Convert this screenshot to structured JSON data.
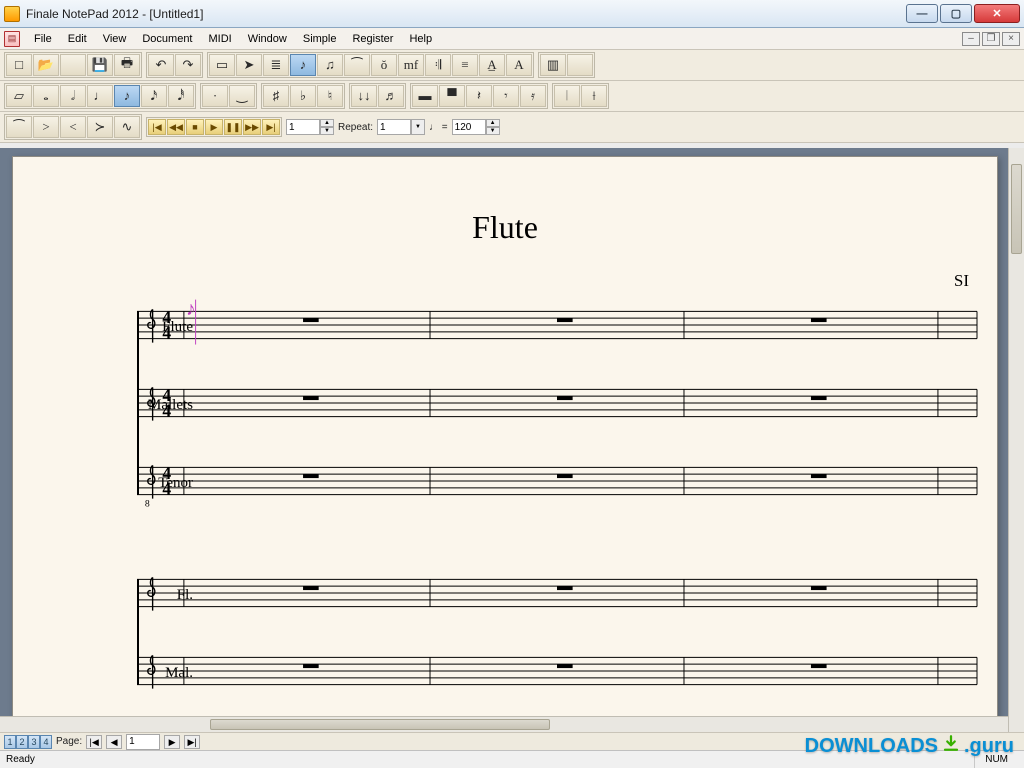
{
  "window": {
    "title": "Finale NotePad 2012 - [Untitled1]"
  },
  "menu": [
    "File",
    "Edit",
    "View",
    "Document",
    "MIDI",
    "Window",
    "Simple",
    "Register",
    "Help"
  ],
  "toolbar1": {
    "groups": [
      {
        "items": [
          {
            "name": "new-icon",
            "glyph": "□"
          },
          {
            "name": "open-icon",
            "glyph": "📂"
          },
          {
            "name": "blank1",
            "glyph": ""
          },
          {
            "name": "save-icon",
            "glyph": "💾"
          },
          {
            "name": "print-icon",
            "glyph": "🖶"
          }
        ]
      },
      {
        "items": [
          {
            "name": "undo-icon",
            "glyph": "↶"
          },
          {
            "name": "redo-icon",
            "glyph": "↷"
          }
        ]
      },
      {
        "items": [
          {
            "name": "select-tool-icon",
            "glyph": "▭"
          },
          {
            "name": "arrow-tool-icon",
            "glyph": "➤"
          },
          {
            "name": "measure-tool-icon",
            "glyph": "≣"
          },
          {
            "name": "simple-entry-icon",
            "glyph": "♪",
            "active": true
          },
          {
            "name": "tuplet-tool-icon",
            "glyph": "♫"
          },
          {
            "name": "slur-tool-icon",
            "glyph": "⁀"
          },
          {
            "name": "articulation-tool-icon",
            "glyph": "ŏ"
          },
          {
            "name": "dyn-tool-icon",
            "glyph": "𝆐",
            "label": "mf"
          },
          {
            "name": "repeat-tool-icon",
            "glyph": "𝄇"
          },
          {
            "name": "lyric-tool-icon",
            "glyph": "≡"
          },
          {
            "name": "text-ul-icon",
            "glyph": "A̲"
          },
          {
            "name": "text-tool-icon",
            "glyph": "A"
          }
        ]
      },
      {
        "items": [
          {
            "name": "page-tool-icon",
            "glyph": "▥"
          },
          {
            "name": "blank2",
            "glyph": ""
          }
        ]
      }
    ]
  },
  "toolbar2": {
    "groups": [
      {
        "items": [
          {
            "name": "eraser-icon",
            "glyph": "▱"
          },
          {
            "name": "whole-note-icon",
            "glyph": "𝅝"
          },
          {
            "name": "half-note-icon",
            "glyph": "𝅗𝅥"
          },
          {
            "name": "quarter-note-icon",
            "glyph": "♩"
          },
          {
            "name": "eighth-note-icon",
            "glyph": "♪",
            "active": true
          },
          {
            "name": "sixteenth-note-icon",
            "glyph": "𝅘𝅥𝅯"
          },
          {
            "name": "thirtysecond-note-icon",
            "glyph": "𝅘𝅥𝅰"
          }
        ]
      },
      {
        "items": [
          {
            "name": "dot-icon",
            "glyph": "·"
          },
          {
            "name": "tie-icon",
            "glyph": "‿"
          }
        ]
      },
      {
        "items": [
          {
            "name": "sharp-icon",
            "glyph": "♯"
          },
          {
            "name": "flat-icon",
            "glyph": "♭"
          },
          {
            "name": "natural-icon",
            "glyph": "♮"
          }
        ]
      },
      {
        "items": [
          {
            "name": "tuplet-icon",
            "glyph": "↓↓"
          },
          {
            "name": "grace-icon",
            "glyph": "♬"
          }
        ]
      },
      {
        "items": [
          {
            "name": "whole-rest-icon",
            "glyph": "▬"
          },
          {
            "name": "half-rest-icon",
            "glyph": "▀"
          },
          {
            "name": "quarter-rest-icon",
            "glyph": "𝄽"
          },
          {
            "name": "eighth-rest-icon",
            "glyph": "𝄾"
          },
          {
            "name": "sixteenth-rest-icon",
            "glyph": "𝄿"
          }
        ]
      },
      {
        "items": [
          {
            "name": "barline-icon",
            "glyph": "𝄀"
          },
          {
            "name": "cut-barline-icon",
            "glyph": "⟊"
          }
        ]
      }
    ]
  },
  "toolbar3": {
    "cresc": [
      {
        "name": "slur-down-icon",
        "glyph": "⁀"
      },
      {
        "name": "decr-icon",
        "glyph": ">"
      },
      {
        "name": "cresc-icon",
        "glyph": "<"
      },
      {
        "name": "cresc2-icon",
        "glyph": "≻"
      },
      {
        "name": "trill-icon",
        "glyph": "∿"
      }
    ],
    "playback": [
      {
        "name": "rewind-full-icon",
        "glyph": "|◀"
      },
      {
        "name": "rewind-icon",
        "glyph": "◀◀"
      },
      {
        "name": "stop-icon",
        "glyph": "■"
      },
      {
        "name": "play-icon",
        "glyph": "▶"
      },
      {
        "name": "pause-icon",
        "glyph": "❚❚"
      },
      {
        "name": "ffwd-icon",
        "glyph": "▶▶"
      },
      {
        "name": "ffwd-full-icon",
        "glyph": "▶|"
      }
    ],
    "measure_value": "1",
    "repeat_label": "Repeat:",
    "repeat_value": "1",
    "tempo_eq": "=",
    "tempo_value": "120"
  },
  "score": {
    "title": "Flute",
    "composer_mark": "SI",
    "systems": [
      {
        "staves": [
          {
            "label": "Flute",
            "clef": "treble",
            "time": "4/4",
            "cursor": true
          },
          {
            "label": "Mallets",
            "clef": "treble",
            "time": "4/4"
          },
          {
            "label": "Tenor",
            "clef": "treble8",
            "time": "4/4"
          }
        ]
      },
      {
        "staves": [
          {
            "label": "Fl.",
            "clef": "treble"
          },
          {
            "label": "Mal.",
            "clef": "treble"
          }
        ]
      }
    ]
  },
  "lowbar": {
    "layers": [
      "1",
      "2",
      "3",
      "4"
    ],
    "page_label": "Page:",
    "page_value": "1"
  },
  "status": {
    "left": "Ready",
    "num": "NUM"
  },
  "watermark": {
    "a": "DOWNLOADS",
    "b": ".guru"
  }
}
